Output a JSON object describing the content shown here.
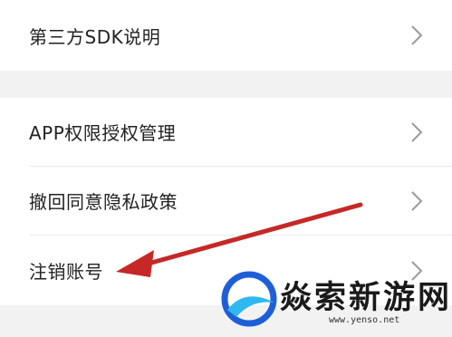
{
  "settings": {
    "items": [
      {
        "label": "第三方SDK说明"
      },
      {
        "label": "APP权限授权管理"
      },
      {
        "label": "撤回同意隐私政策"
      },
      {
        "label": "注销账号"
      }
    ]
  },
  "annotation": {
    "arrow_color": "#c62828"
  },
  "watermark": {
    "brand": "焱索新游网",
    "url": "www.yenso.net",
    "logo_colors": [
      "#1e5fd8",
      "#2fb8f0"
    ]
  }
}
